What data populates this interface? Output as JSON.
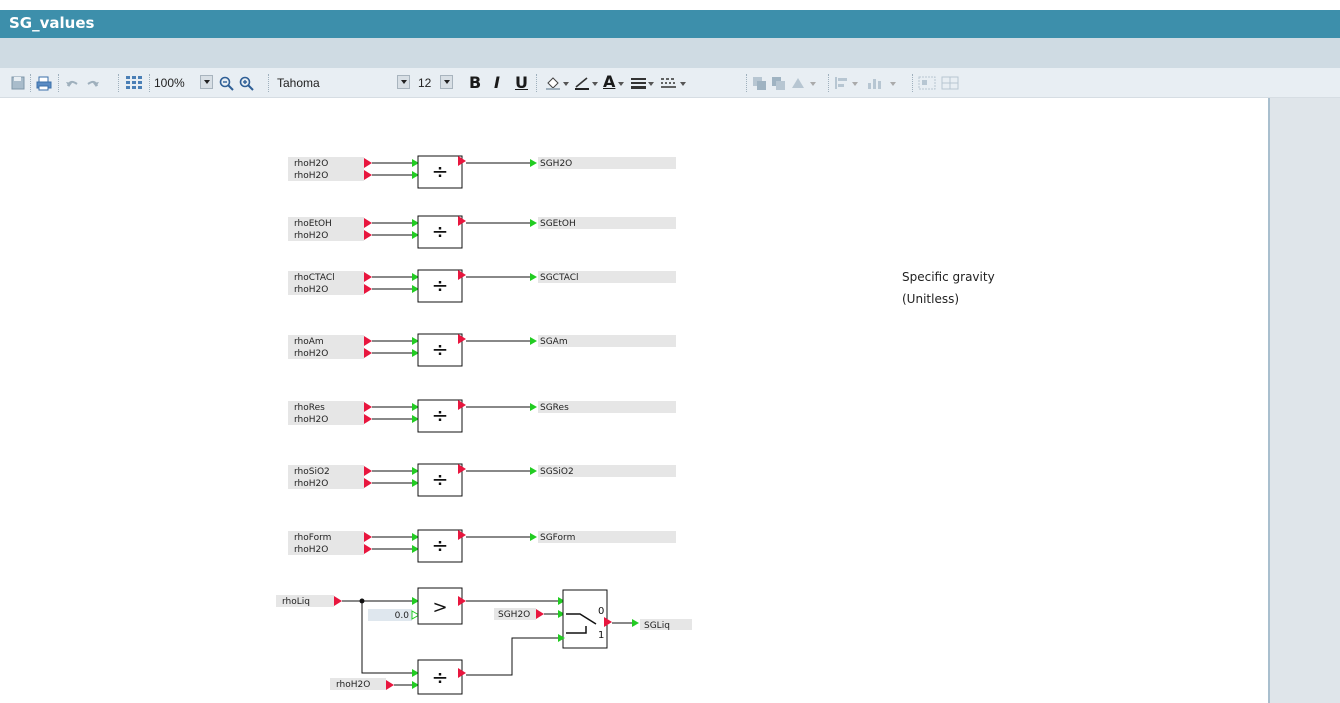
{
  "window": {
    "title": "SG_values"
  },
  "toolbar": {
    "zoom": "100%",
    "font": "Tahoma",
    "font_size": "12",
    "bold": "B",
    "italic": "I",
    "underline": "U",
    "font_color_glyph": "A"
  },
  "blocks": [
    {
      "in1": "rhoH2O",
      "in2": "rhoH2O",
      "op": "÷",
      "out": "SGH2O"
    },
    {
      "in1": "rhoEtOH",
      "in2": "rhoH2O",
      "op": "÷",
      "out": "SGEtOH"
    },
    {
      "in1": "rhoCTACl",
      "in2": "rhoH2O",
      "op": "÷",
      "out": "SGCTACl"
    },
    {
      "in1": "rhoAm",
      "in2": "rhoH2O",
      "op": "÷",
      "out": "SGAm"
    },
    {
      "in1": "rhoRes",
      "in2": "rhoH2O",
      "op": "÷",
      "out": "SGRes"
    },
    {
      "in1": "rhoSiO2",
      "in2": "rhoH2O",
      "op": "÷",
      "out": "SGSiO2"
    },
    {
      "in1": "rhoForm",
      "in2": "rhoH2O",
      "op": "÷",
      "out": "SGForm"
    }
  ],
  "liquid": {
    "input": "rhoLiq",
    "constant": "0.0",
    "compare_op": ">",
    "divider_input": "rhoH2O",
    "divide_op": "÷",
    "switch_input": "SGH2O",
    "switch_label_0": "0",
    "switch_label_1": "1",
    "output": "SGLiq"
  },
  "note": {
    "line1": "Specific gravity",
    "line2": "(Unitless)"
  },
  "colors": {
    "title_bar": "#3d8fab",
    "input_port": "#e8163e",
    "output_port": "#22cc22",
    "label_bg": "#e6e6e6"
  }
}
